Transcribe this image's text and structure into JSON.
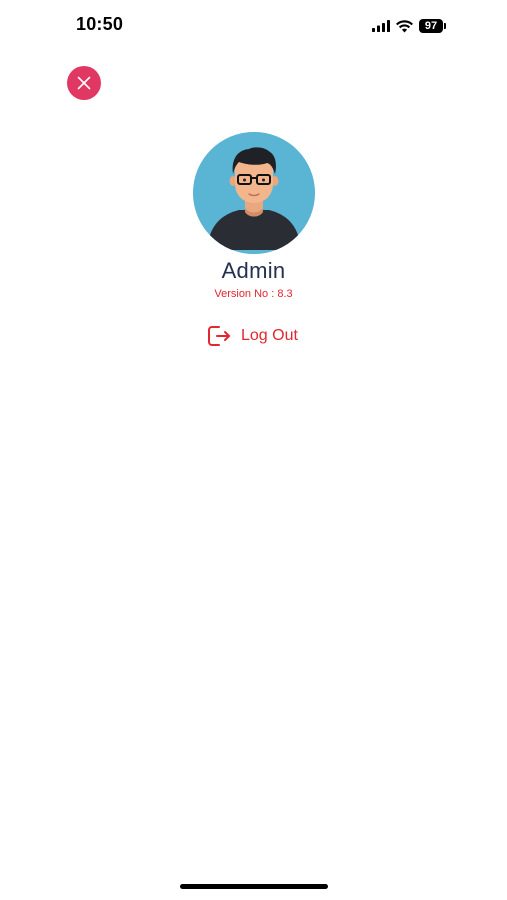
{
  "status_bar": {
    "time": "10:50",
    "battery_level": "97",
    "icons": [
      "signal-icon",
      "wifi-icon",
      "battery-icon"
    ]
  },
  "close_button": {
    "icon": "close-icon",
    "color": "#e13763"
  },
  "profile": {
    "avatar_icon": "avatar-icon",
    "name": "Admin",
    "version_text": "Version No : 8.3"
  },
  "logout": {
    "icon": "logout-icon",
    "label": "Log Out",
    "color": "#e3262f"
  }
}
